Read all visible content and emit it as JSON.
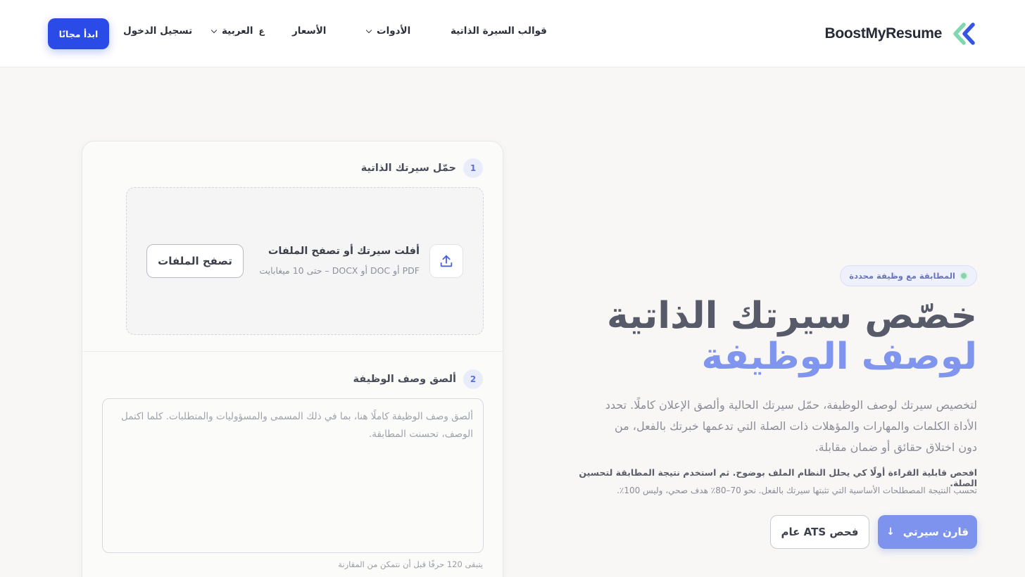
{
  "nav": {
    "brand": "BoostMyResume",
    "items": [
      {
        "label": "قوالب السيرة الذاتية"
      },
      {
        "label": "الأدوات"
      },
      {
        "label": "الأسعار"
      }
    ],
    "language": {
      "glyph": "ع",
      "label": "العربية"
    },
    "login": "تسجيل الدخول",
    "cta": "ابدأ مجانًا"
  },
  "hero": {
    "badge": "المطابقة مع وظيفة محددة",
    "title_line1": "خصّص سيرتك الذاتية",
    "title_line2": "لوصف الوظيفة",
    "description": "لتخصيص سيرتك لوصف الوظيفة، حمّل سيرتك الحالية وألصق الإعلان كاملًا. تحدد الأداة الكلمات والمهارات والمؤهلات ذات الصلة التي تدعمها خبرتك بالفعل، من دون اختلاق حقائق أو ضمان مقابلة.",
    "note_bold": "افحص قابلية القراءة أولًا كي يحلل النظام الملف بوضوح. ثم استخدم نتيجة المطابقة لتحسين الصلة.",
    "note": "تحسب النتيجة المصطلحات الأساسية التي تثبتها سيرتك بالفعل. نحو 70–80٪ هدف صحي، وليس 100٪.",
    "primary_button": "قارن سيرتي",
    "secondary_button": "فحص ATS عام"
  },
  "upload": {
    "step_number": "1",
    "step_label": "حمّل سيرتك الذاتية",
    "drop_title": "أفلت سيرتك أو تصفح الملفات",
    "drop_subtitle": "PDF أو DOC أو DOCX – حتى 10 ميغابايت",
    "browse_button": "تصفح الملفات"
  },
  "job": {
    "step_number": "2",
    "step_label": "ألصق وصف الوظيفة",
    "placeholder": "ألصق وصف الوظيفة كاملًا هنا، بما في ذلك المسمى والمسؤوليات والمتطلبات. كلما اكتمل الوصف، تحسنت المطابقة.",
    "counter": "يتبقى 120 حرفًا قبل أن نتمكن من المقارنة"
  },
  "colors": {
    "accent": "#2b4be8",
    "accent_light": "#7d93ee",
    "title_gray": "#565a69",
    "badge_dot": "#88d4ad"
  },
  "icons": [
    "brand-chevrons-icon",
    "chevron-down-icon",
    "upload-icon",
    "arrow-down-icon"
  ]
}
